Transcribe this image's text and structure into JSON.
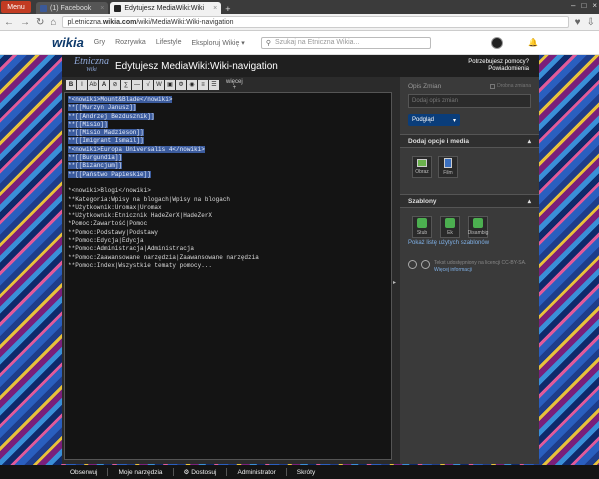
{
  "browser": {
    "menu_label": "Menu",
    "tabs": [
      {
        "label": "(1) Facebook"
      },
      {
        "label": "Edytujesz MediaWiki:Wiki"
      }
    ],
    "url_prefix": "pl.etniczna.",
    "url_domain": "wikia.com",
    "url_path": "/wiki/MediaWiki:Wiki-navigation"
  },
  "wikia": {
    "logo": "wikia",
    "nav": [
      "Gry",
      "Rozrywka",
      "Lifestyle",
      "Eksploruj Wikię ▾"
    ],
    "search_placeholder": "Szukaj na Etniczna Wikia..."
  },
  "header": {
    "wiki_logo_top": "Etniczna",
    "wiki_logo_bottom": "Wiki",
    "title": "Edytujesz MediaWiki:Wiki-navigation",
    "help_line1": "Potrzebujesz pomocy?",
    "help_line2": "Powiadomienia"
  },
  "toolbar": {
    "buttons": [
      "B",
      "I",
      "Ab",
      "A",
      "⊘",
      "∑",
      "—",
      "√",
      "W",
      "▣",
      "Φ",
      "◉",
      "≡",
      "☰"
    ],
    "more": "więcej"
  },
  "editor": {
    "lines": [
      {
        "hl": true,
        "text": "*<nowiki>Mount&Blade</nowiki>"
      },
      {
        "hl": true,
        "text": "**[[Murzyn Janusz]]"
      },
      {
        "hl": true,
        "text": "**[[Andrzej Bezduszník]]"
      },
      {
        "hl": true,
        "text": "**[[Misio]]"
      },
      {
        "hl": true,
        "text": "**[[Misio Madzieson]]"
      },
      {
        "hl": true,
        "text": "**[[Imigrant Ismail]]"
      },
      {
        "hl": true,
        "text": "*<nowiki>Europa Universalis 4</nowiki>"
      },
      {
        "hl": true,
        "text": "**[[Burgundia]]"
      },
      {
        "hl": true,
        "text": "**[[Bizancjum]]"
      },
      {
        "hl": true,
        "text": "**[[Państwo Papieskie]]"
      },
      {
        "hl": false,
        "text": ""
      },
      {
        "hl": false,
        "text": "*<nowiki>Blogi</nowiki>"
      },
      {
        "hl": false,
        "text": "**Kategoria:Wpisy na blogach|Wpisy na blogach"
      },
      {
        "hl": false,
        "text": "**Użytkownik:Uromax|Uromax"
      },
      {
        "hl": false,
        "text": "**Użytkownik:Etnicznik HadeZerX|HadeZerX"
      },
      {
        "hl": false,
        "text": "*Pomoc:Zawartość|Pomoc"
      },
      {
        "hl": false,
        "text": "**Pomoc:Podstawy|Podstawy"
      },
      {
        "hl": false,
        "text": "**Pomoc:Edycja|Edycja"
      },
      {
        "hl": false,
        "text": "**Pomoc:Administracja|Administracja"
      },
      {
        "hl": false,
        "text": "**Pomoc:Zaawansowane narzędzia|Zaawansowane narzędzia"
      },
      {
        "hl": false,
        "text": "**Pomoc:Index|Wszystkie tematy pomocy..."
      }
    ]
  },
  "sidebar": {
    "summary_label": "Opis Zmian",
    "minor_edit": "Drobna zmiana",
    "summary_placeholder": "Dodaj opis zmian",
    "preview_label": "Podgląd",
    "options_title": "Dodaj opcje i media",
    "image_label": "Obraz",
    "film_label": "Film",
    "templates_title": "Szablony",
    "templates": [
      "Stub",
      "Ek",
      "Disambig"
    ],
    "templates_link": "Pokaż listę użytych szablonów",
    "license_text": "Tekst udostępniony na licencji CC-BY-SA.",
    "license_link": "Więcej informacji"
  },
  "bottombar": {
    "items": [
      "Obserwuj",
      "Moje narzędzia",
      "Dostosuj",
      "Administrator",
      "Skróty"
    ]
  }
}
